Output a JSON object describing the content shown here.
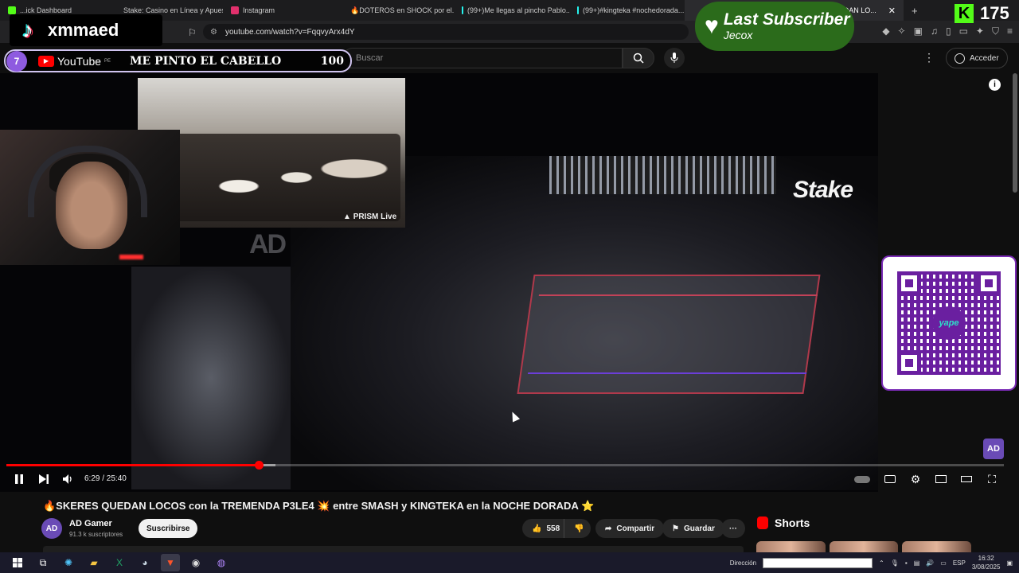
{
  "browser": {
    "tabs": [
      {
        "label": "...ick Dashboard",
        "color": "#53fc18",
        "active": false
      },
      {
        "label": "Stake: Casino en Línea y Apues...",
        "color": "#1a2c38",
        "active": false
      },
      {
        "label": "Instagram",
        "color": "#e1306c",
        "active": false
      },
      {
        "label": "🔥DOTEROS en SHOCK por el...",
        "color": "#ff0000",
        "active": false
      },
      {
        "label": "(99+)Me llegas al pincho Pablo...",
        "color": "#000000",
        "active": false
      },
      {
        "label": "(99+)#kingteka #nochedorada...",
        "color": "#000000",
        "active": false
      },
      {
        "label": "QUEDAN LO...",
        "color": "#ff0000",
        "active": true
      }
    ],
    "new_tab": "+",
    "url": "youtube.com/watch?v=FqqvyArx4dY"
  },
  "youtube": {
    "search_placeholder": "Buscar",
    "search_icon": "search-icon",
    "signin_label": "Acceder",
    "logo_label": "YouTube",
    "logo_region": "PE"
  },
  "overlays": {
    "tiktok_name": "xmmaed",
    "goal_number": "7",
    "goal_title": "ME PINTO EL CABELLO",
    "goal_count": "100",
    "last_sub_title": "Last Subscriber",
    "last_sub_name": "Jecox",
    "kick_count": "175",
    "prism_label": "PRISM Live",
    "stake_brand": "Stake",
    "ad_watermark": "AD",
    "ad_gamer_logo": "AD",
    "qr_brand": "yape"
  },
  "player": {
    "current_time": "6:29",
    "duration": "25:40",
    "time_display": "6:29 / 25:40",
    "progress": 0.2526,
    "buffered": 0.27
  },
  "video": {
    "title": "🔥SKERES QUEDAN LOCOS con la TREMENDA P3LE4 💥 entre SMASH y KINGTEKA en la NOCHE DORADA ⭐",
    "channel_name": "AD Gamer",
    "channel_avatar": "AD",
    "channel_subs": "91.3 k suscriptores",
    "subscribe_label": "Suscribirse",
    "likes": "558",
    "share_label": "Compartir",
    "save_label": "Guardar",
    "more_label": "···"
  },
  "sidebar": {
    "shorts_label": "Shorts"
  },
  "taskbar": {
    "address_label": "Dirección",
    "lang": "ESP",
    "time": "16:32",
    "date": "3/08/2025"
  },
  "colors": {
    "accent": "#ff0000",
    "kick": "#53fc18",
    "purple": "#6a1fa0"
  }
}
